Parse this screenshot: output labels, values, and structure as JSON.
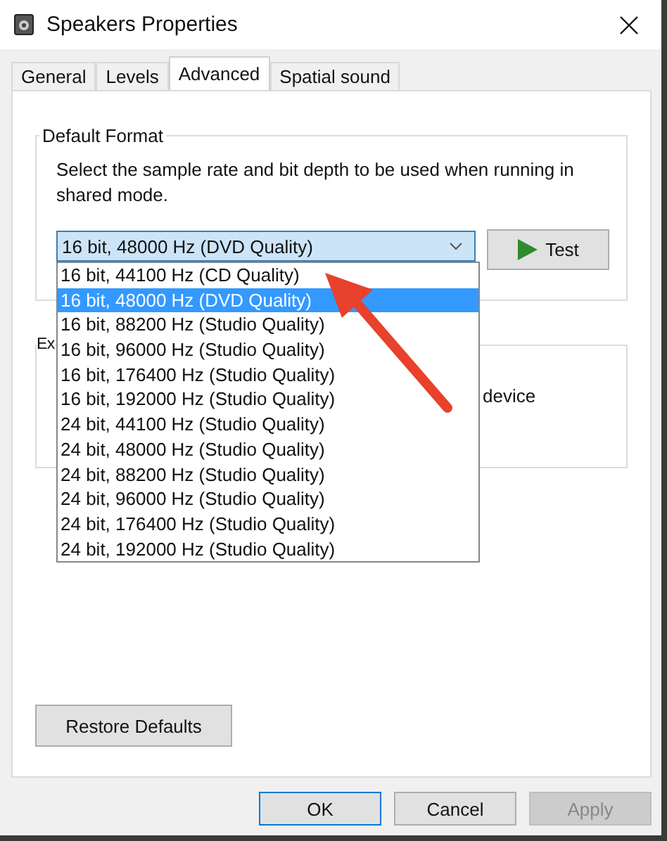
{
  "window": {
    "title": "Speakers Properties"
  },
  "tabs": [
    {
      "label": "General",
      "selected": false
    },
    {
      "label": "Levels",
      "selected": false
    },
    {
      "label": "Advanced",
      "selected": true
    },
    {
      "label": "Spatial sound",
      "selected": false
    }
  ],
  "default_format": {
    "label": "Default Format",
    "description": "Select the sample rate and bit depth to be used when running in shared mode.",
    "dropdown": {
      "value": "16 bit, 48000 Hz (DVD Quality)",
      "expanded": true,
      "options": [
        {
          "label": "16 bit, 44100 Hz (CD Quality)",
          "selected": false
        },
        {
          "label": "16 bit, 48000 Hz (DVD Quality)",
          "selected": true
        },
        {
          "label": "16 bit, 88200 Hz (Studio Quality)",
          "selected": false
        },
        {
          "label": "16 bit, 96000 Hz (Studio Quality)",
          "selected": false
        },
        {
          "label": "16 bit, 176400 Hz (Studio Quality)",
          "selected": false
        },
        {
          "label": "16 bit, 192000 Hz (Studio Quality)",
          "selected": false
        },
        {
          "label": "24 bit, 44100 Hz (Studio Quality)",
          "selected": false
        },
        {
          "label": "24 bit, 48000 Hz (Studio Quality)",
          "selected": false
        },
        {
          "label": "24 bit, 88200 Hz (Studio Quality)",
          "selected": false
        },
        {
          "label": "24 bit, 96000 Hz (Studio Quality)",
          "selected": false
        },
        {
          "label": "24 bit, 176400 Hz (Studio Quality)",
          "selected": false
        },
        {
          "label": "24 bit, 192000 Hz (Studio Quality)",
          "selected": false
        }
      ]
    },
    "test_button": "Test"
  },
  "exclusive_group": {
    "label": "Ex",
    "text": "device"
  },
  "annotation": {
    "kind": "arrow"
  },
  "restore_button": "Restore Defaults",
  "buttons": [
    {
      "label": "OK",
      "default": true,
      "disabled": false
    },
    {
      "label": "Cancel",
      "default": false,
      "disabled": false
    },
    {
      "label": "Apply",
      "default": false,
      "disabled": true
    }
  ]
}
